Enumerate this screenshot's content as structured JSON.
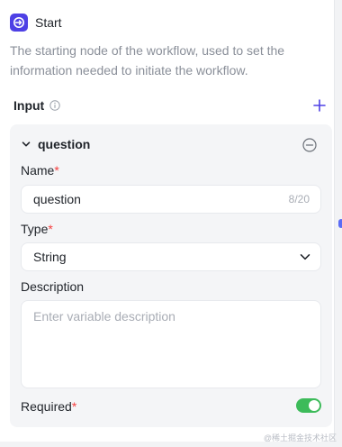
{
  "node": {
    "title": "Start",
    "icon": "start-node-icon",
    "accent": "#4e40e5",
    "description": "The starting node of the workflow, used to set the information needed to initiate the workflow."
  },
  "inputs": {
    "label": "Input",
    "info_icon": "info-icon",
    "add_icon": "plus-icon",
    "variable": {
      "name": "question",
      "expand_icon": "chevron-down-icon",
      "remove_icon": "minus-circle-icon",
      "name_label": "Name",
      "name_value": "question",
      "name_count": "8/20",
      "type_label": "Type",
      "type_value": "String",
      "description_label": "Description",
      "description_placeholder": "Enter variable description",
      "required_label": "Required",
      "required_on": true,
      "toggle_color": "#3dbb5a"
    }
  },
  "required_marker": "*",
  "watermark": "@稀土掘金技术社区"
}
